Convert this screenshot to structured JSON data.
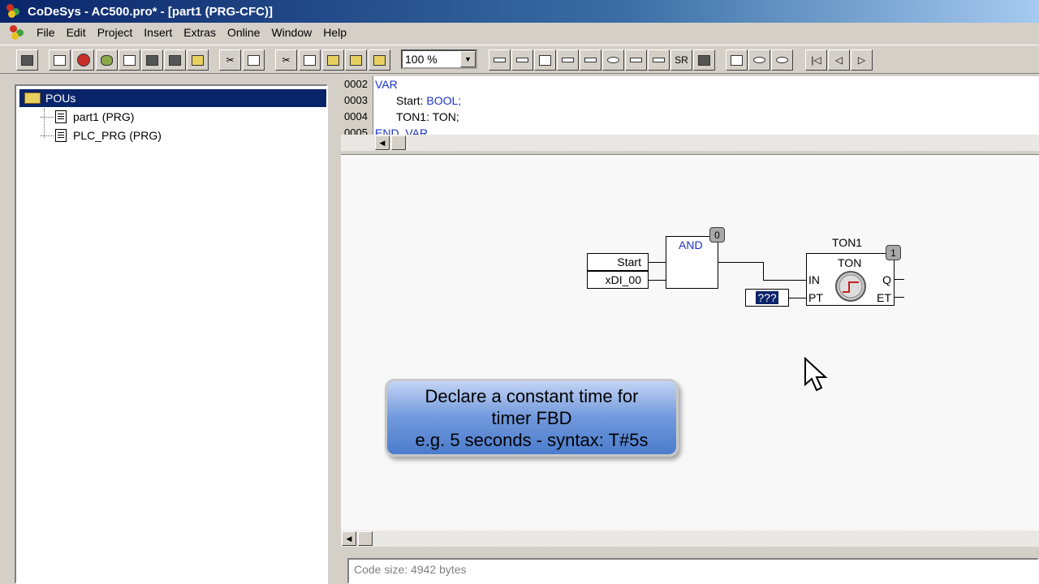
{
  "window": {
    "title": "CoDeSys - AC500.pro* - [part1 (PRG-CFC)]"
  },
  "menu": [
    "File",
    "Edit",
    "Project",
    "Insert",
    "Extras",
    "Online",
    "Window",
    "Help"
  ],
  "toolbar": {
    "zoom": "100 %"
  },
  "tree": {
    "root": "POUs",
    "items": [
      "part1 (PRG)",
      "PLC_PRG (PRG)"
    ]
  },
  "declaration": {
    "lines": [
      {
        "num": "0002",
        "keyword": "VAR",
        "text": ""
      },
      {
        "num": "0003",
        "keyword": "",
        "text": "Start: ",
        "type": "BOOL;"
      },
      {
        "num": "0004",
        "keyword": "",
        "text": "TON1: TON;"
      },
      {
        "num": "0005",
        "keyword": "END_VAR",
        "text": ""
      }
    ]
  },
  "diagram": {
    "input_start": "Start",
    "input_xdi": "xDI_00",
    "and_label": "AND",
    "and_order": "0",
    "ton_instance": "TON1",
    "ton_type": "TON",
    "ton_order": "1",
    "pin_in": "IN",
    "pin_pt": "PT",
    "pin_q": "Q",
    "pin_et": "ET",
    "pt_value": "???"
  },
  "tooltip": {
    "line1": "Declare a constant time for",
    "line2": "timer FBD",
    "line3": "e.g. 5 seconds - syntax: T#5s"
  },
  "status": {
    "text": "Code size: 4942 bytes"
  }
}
